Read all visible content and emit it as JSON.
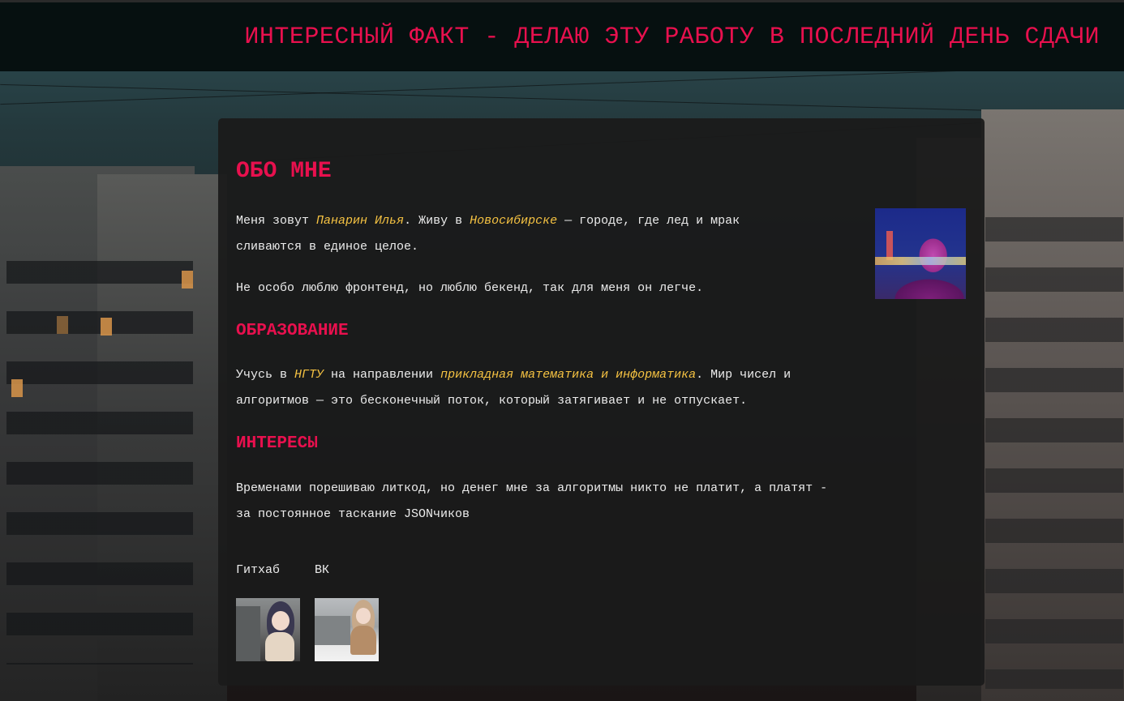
{
  "header": {
    "title": "ИНТЕРЕСНЫЙ ФАКТ - ДЕЛАЮ ЭТУ РАБОТУ В ПОСЛЕДНИЙ ДЕНЬ СДАЧИ"
  },
  "about": {
    "title": "ОБО МНЕ",
    "p1_before": "Меня зовут ",
    "name": "Панарин Илья",
    "p1_mid": ". Живу в ",
    "city": "Новосибирске",
    "p1_after_line1": " — городе, где лед и мрак",
    "p1_line2": "сливаются в единое целое.",
    "p2": "Не особо люблю фронтенд, но люблю бекенд, так для меня он легче."
  },
  "education": {
    "title": "ОБРАЗОВАНИЕ",
    "before": "Учусь в ",
    "university": "НГТУ",
    "mid": " на направлении ",
    "major": "прикладная математика и информатика",
    "after_line1": ". Мир чисел и",
    "line2": "алгоритмов — это бесконечный поток, который затягивает и не отпускает."
  },
  "interests": {
    "title": "ИНТЕРЕСЫ",
    "line1": "Временами порешиваю литкод, но денег мне за алгоритмы никто не платит, а платят -",
    "line2": "за постоянное таскание JSONчиков"
  },
  "links": {
    "github_label": "Гитхаб",
    "vk_label": "ВК"
  },
  "colors": {
    "accent": "#e8104e",
    "highlight": "#f5c242",
    "text": "#ececec",
    "card": "#1b1b1b",
    "header": "#061010"
  },
  "icons": {
    "avatar": "profile-photo",
    "github_thumb": "anime-girl-image",
    "vk_thumb": "anime-girl-winter-image"
  }
}
